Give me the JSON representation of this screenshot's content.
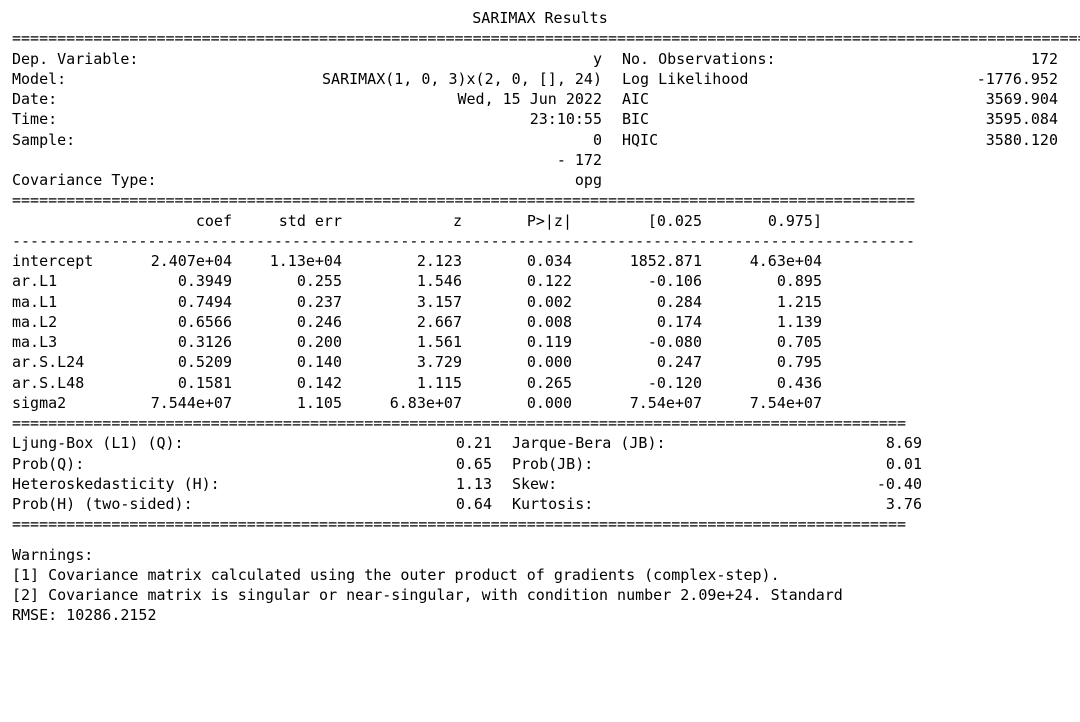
{
  "title": "SARIMAX Results",
  "rule_full": "==============================================================================================================================",
  "rule_coef": "====================================================================================================",
  "dash_coef": "----------------------------------------------------------------------------------------------------",
  "rule_diag": "===================================================================================================",
  "header_left": [
    {
      "label": "Dep. Variable:",
      "value": "y"
    },
    {
      "label": "Model:",
      "value": "SARIMAX(1, 0, 3)x(2, 0, [], 24)"
    },
    {
      "label": "Date:",
      "value": "Wed, 15 Jun 2022"
    },
    {
      "label": "Time:",
      "value": "23:10:55"
    },
    {
      "label": "Sample:",
      "value": "0"
    },
    {
      "label": "",
      "value": "- 172"
    },
    {
      "label": "Covariance Type:",
      "value": "opg"
    }
  ],
  "header_right": [
    {
      "label": "No. Observations:",
      "value": "172"
    },
    {
      "label": "Log Likelihood",
      "value": "-1776.952"
    },
    {
      "label": "AIC",
      "value": "3569.904"
    },
    {
      "label": "BIC",
      "value": "3595.084"
    },
    {
      "label": "HQIC",
      "value": "3580.120"
    },
    {
      "label": "",
      "value": ""
    },
    {
      "label": "",
      "value": ""
    }
  ],
  "coef_header": {
    "c0": "",
    "c1": "coef",
    "c2": "std err",
    "c3": "z",
    "c4": "P>|z|",
    "c5": "[0.025",
    "c6": "0.975]"
  },
  "coef_rows": [
    {
      "name": "intercept",
      "coef": "2.407e+04",
      "se": "1.13e+04",
      "z": "2.123",
      "p": "0.034",
      "lo": "1852.871",
      "hi": "4.63e+04"
    },
    {
      "name": "ar.L1",
      "coef": "0.3949",
      "se": "0.255",
      "z": "1.546",
      "p": "0.122",
      "lo": "-0.106",
      "hi": "0.895"
    },
    {
      "name": "ma.L1",
      "coef": "0.7494",
      "se": "0.237",
      "z": "3.157",
      "p": "0.002",
      "lo": "0.284",
      "hi": "1.215"
    },
    {
      "name": "ma.L2",
      "coef": "0.6566",
      "se": "0.246",
      "z": "2.667",
      "p": "0.008",
      "lo": "0.174",
      "hi": "1.139"
    },
    {
      "name": "ma.L3",
      "coef": "0.3126",
      "se": "0.200",
      "z": "1.561",
      "p": "0.119",
      "lo": "-0.080",
      "hi": "0.705"
    },
    {
      "name": "ar.S.L24",
      "coef": "0.5209",
      "se": "0.140",
      "z": "3.729",
      "p": "0.000",
      "lo": "0.247",
      "hi": "0.795"
    },
    {
      "name": "ar.S.L48",
      "coef": "0.1581",
      "se": "0.142",
      "z": "1.115",
      "p": "0.265",
      "lo": "-0.120",
      "hi": "0.436"
    },
    {
      "name": "sigma2",
      "coef": "7.544e+07",
      "se": "1.105",
      "z": "6.83e+07",
      "p": "0.000",
      "lo": "7.54e+07",
      "hi": "7.54e+07"
    }
  ],
  "diag_rows": [
    {
      "l": "Ljung-Box (L1) (Q):",
      "lv": "0.21",
      "r": "Jarque-Bera (JB):",
      "rv": "8.69"
    },
    {
      "l": "Prob(Q):",
      "lv": "0.65",
      "r": "Prob(JB):",
      "rv": "0.01"
    },
    {
      "l": "Heteroskedasticity (H):",
      "lv": "1.13",
      "r": "Skew:",
      "rv": "-0.40"
    },
    {
      "l": "Prob(H) (two-sided):",
      "lv": "0.64",
      "r": "Kurtosis:",
      "rv": "3.76"
    }
  ],
  "warnings_label": "Warnings:",
  "warnings": [
    "[1] Covariance matrix calculated using the outer product of gradients (complex-step).",
    "[2] Covariance matrix is singular or near-singular, with condition number 2.09e+24. Standard"
  ],
  "rmse": "RMSE: 10286.2152"
}
